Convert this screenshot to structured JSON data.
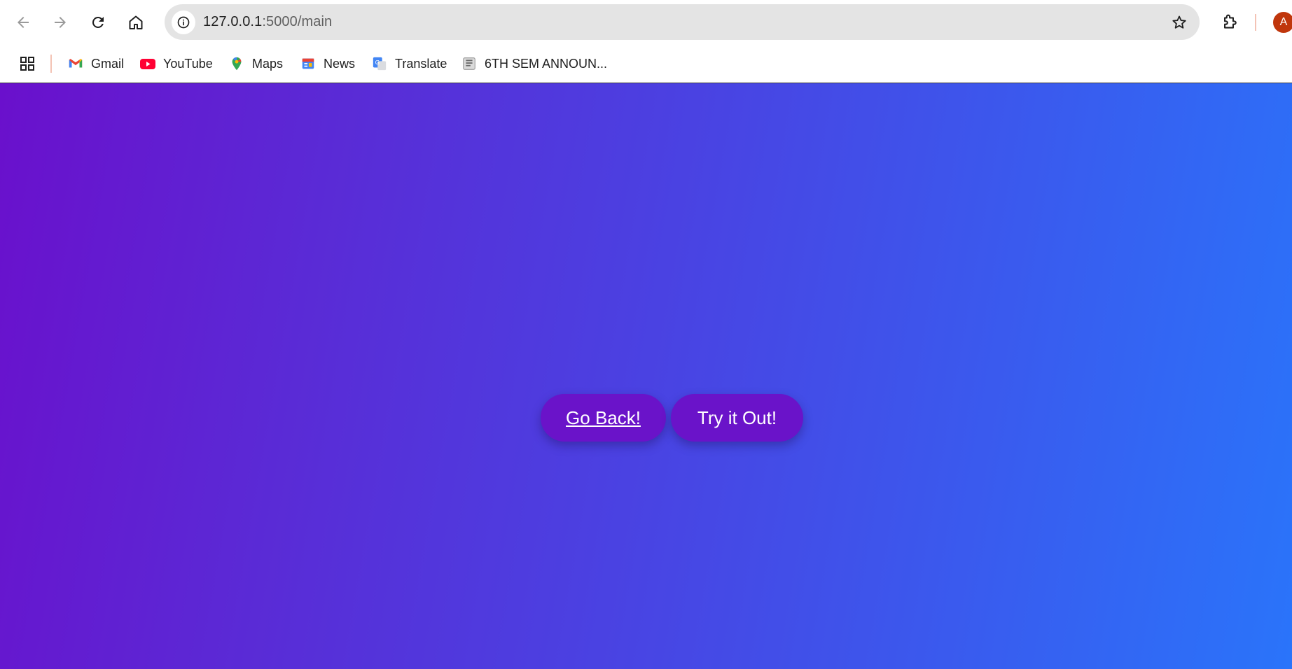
{
  "browser": {
    "url_host": "127.0.0.1",
    "url_path": ":5000/main",
    "avatar_letter": "A",
    "colors": {
      "omnibox_bg": "#e4e4e4",
      "avatar_bg": "#c0360c"
    }
  },
  "bookmarks": [
    {
      "label": "Gmail",
      "icon": "gmail-icon"
    },
    {
      "label": "YouTube",
      "icon": "youtube-icon"
    },
    {
      "label": "Maps",
      "icon": "maps-icon"
    },
    {
      "label": "News",
      "icon": "news-icon"
    },
    {
      "label": "Translate",
      "icon": "translate-icon"
    },
    {
      "label": "6TH SEM ANNOUN...",
      "icon": "document-icon"
    }
  ],
  "page": {
    "buttons": {
      "back_label": "Go Back!",
      "try_label": "Try it Out!"
    },
    "colors": {
      "gradient_start": "#6a10cc",
      "gradient_end": "#2a74fa",
      "button_bg": "#6a13c9"
    }
  }
}
